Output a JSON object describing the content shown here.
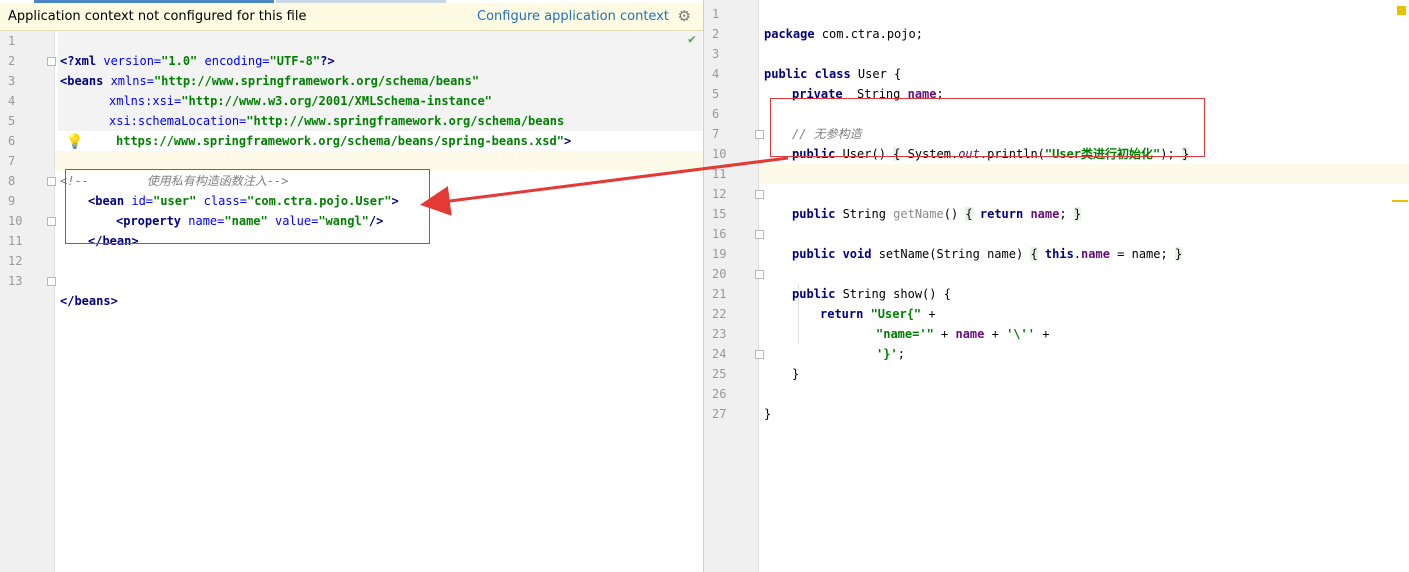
{
  "banner": {
    "message": "Application context not configured for this file",
    "link": "Configure application context",
    "gear_icon": "gear-icon"
  },
  "xml_lines": [
    {
      "n": "1"
    },
    {
      "n": "2"
    },
    {
      "n": "3"
    },
    {
      "n": "4"
    },
    {
      "n": "5"
    },
    {
      "n": "6"
    },
    {
      "n": "7"
    },
    {
      "n": "8"
    },
    {
      "n": "9"
    },
    {
      "n": "10"
    },
    {
      "n": "11"
    },
    {
      "n": "12"
    },
    {
      "n": "13"
    }
  ],
  "xml": {
    "l1_decl_open": "<?xml",
    "l1_attr1": " version=",
    "l1_val1": "\"1.0\"",
    "l1_attr2": " encoding=",
    "l1_val2": "\"UTF-8\"",
    "l1_close": "?>",
    "l2_tag": "<beans",
    "l2_attr": " xmlns=",
    "l2_val": "\"http://www.springframework.org/schema/beans\"",
    "l3_attr": "xmlns:xsi=",
    "l3_val": "\"http://www.w3.org/2001/XMLSchema-instance\"",
    "l4_attr": "xsi:schemaLocation=",
    "l4_val": "\"http://www.springframework.org/schema/beans",
    "l5_val": "https://www.springframework.org/schema/beans/spring-beans.xsd\"",
    "l5_close": ">",
    "l7_comment": "<!--        使用私有构造函数注入-->",
    "l8_tag": "<bean",
    "l8_attr1": " id=",
    "l8_val1": "\"user\"",
    "l8_attr2": " class=",
    "l8_val2": "\"com.ctra.pojo.User\"",
    "l8_close": ">",
    "l9_tag": "<property",
    "l9_attr1": " name=",
    "l9_val1": "\"name\"",
    "l9_attr2": " value=",
    "l9_val2": "\"wangl\"",
    "l9_close": "/>",
    "l10_tag": "</bean>",
    "l13_tag": "</beans>"
  },
  "java_lines": [
    "1",
    "2",
    "3",
    "4",
    "5",
    "6",
    "7",
    "10",
    "11",
    "12",
    "15",
    "16",
    "19",
    "20",
    "21",
    "22",
    "23",
    "24",
    "25",
    "26",
    "27"
  ],
  "java": {
    "l1_kw": "package",
    "l1_rest": " com.ctra.pojo;",
    "l3_kw": "public class",
    "l3_rest": " User {",
    "l4_kw": "private",
    "l4_type": "  String ",
    "l4_field": "name",
    "l4_end": ";",
    "l6_comment": "// 无参构造",
    "l7_kw": "public",
    "l7_sig": " User() ",
    "l7_open": "{",
    "l7_sys": " System.",
    "l7_out": "out",
    "l7_call": ".println(",
    "l7_str": "\"User类进行初始化\"",
    "l7_end": "); ",
    "l7_close": "}",
    "l12_kw": "public",
    "l12_type": " String ",
    "l12_name": "getName",
    "l12_paren": "() ",
    "l12_open": "{",
    "l12_ret": " return ",
    "l12_field": "name",
    "l12_semi": "; ",
    "l12_close": "}",
    "l16_kw": "public void",
    "l16_sig": " setName(String name) ",
    "l16_open": "{",
    "l16_this": " this",
    "l16_dot": ".",
    "l16_field": "name",
    "l16_assign": " = name; ",
    "l16_close": "}",
    "l20_kw": "public",
    "l20_rest": " String show() {",
    "l21_kw": "return",
    "l21_str": " \"User{\"",
    "l21_plus": " +",
    "l22_str": "\"name='\"",
    "l22_plus1": " + ",
    "l22_field": "name",
    "l22_plus2": " + ",
    "l22_char": "'\\''",
    "l22_plus3": " +",
    "l23_char": "'}'",
    "l23_semi": ";",
    "l24_close": "}",
    "l26_close": "}"
  }
}
